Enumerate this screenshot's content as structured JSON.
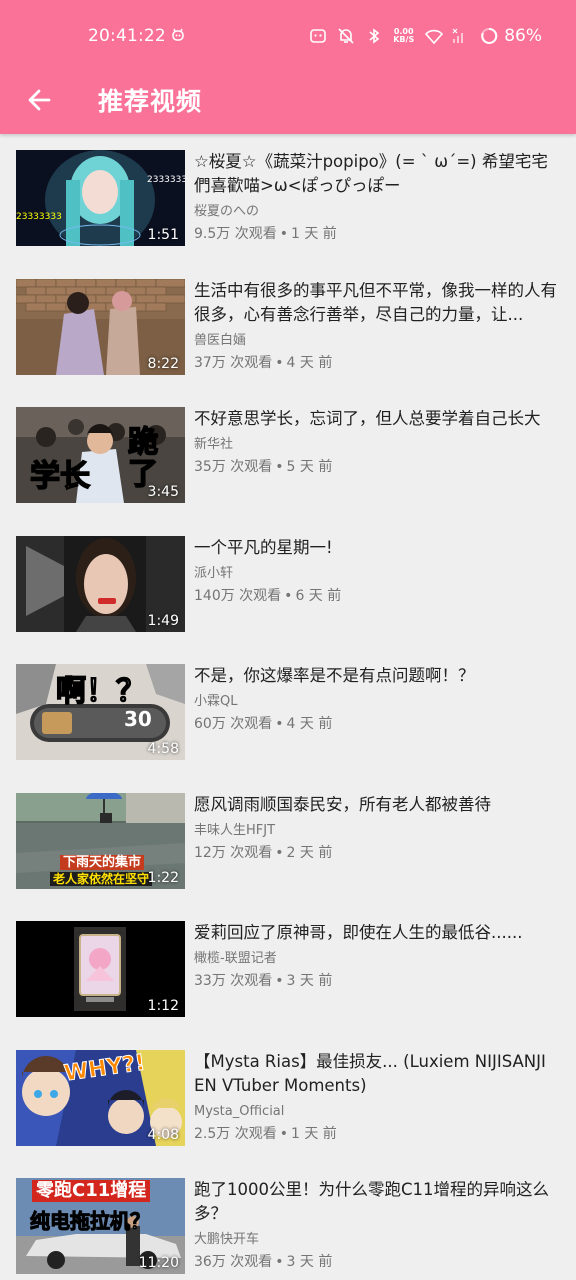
{
  "status_bar": {
    "time": "20:41:22",
    "speed_top": "0.00",
    "speed_unit": "KB/S",
    "battery": "86%"
  },
  "app_bar": {
    "title": "推荐视频"
  },
  "videos": [
    {
      "title": "☆桜夏☆《蔬菜汁popipo》(= ` ω´=) 希望宅宅們喜歡喵>ω<ぽっぴっぽー",
      "channel": "桜夏のへの",
      "views": "9.5万 次观看",
      "age": "1 天 前",
      "duration": "1:51",
      "thumb_overlay": "23333333"
    },
    {
      "title": "生活中有很多的事平凡但不平常，像我一样的人有很多，心有善念行善举，尽自己的力量，让...",
      "channel": "兽医白婳",
      "views": "37万 次观看",
      "age": "4 天 前",
      "duration": "8:22"
    },
    {
      "title": "不好意思学长，忘词了，但人总要学着自己长大",
      "channel": "新华社",
      "views": "35万 次观看",
      "age": "5 天 前",
      "duration": "3:45",
      "thumb_caption_left": "学长",
      "thumb_caption_right": "跪了"
    },
    {
      "title": "一个平凡的星期一!",
      "channel": "派小轩",
      "views": "140万 次观看",
      "age": "6 天 前",
      "duration": "1:49"
    },
    {
      "title": "不是，你这爆率是不是有点问题啊！？",
      "channel": "小霖QL",
      "views": "60万 次观看",
      "age": "4 天 前",
      "duration": "4:58",
      "thumb_caption": "啊！？",
      "thumb_number": "30"
    },
    {
      "title": "愿风调雨顺国泰民安，所有老人都被善待",
      "channel": "丰味人生HFJT",
      "views": "12万 次观看",
      "age": "2 天 前",
      "duration": "1:22",
      "thumb_caption_1": "下雨天的集市",
      "thumb_caption_2": "老人家依然在坚守"
    },
    {
      "title": "爱莉回应了原神哥，即使在人生的最低谷......",
      "channel": "橄榄-联盟记者",
      "views": "33万 次观看",
      "age": "3 天 前",
      "duration": "1:12"
    },
    {
      "title": "【Mysta Rias】最佳损友... (Luxiem NIJISANJI EN VTuber Moments)",
      "channel": "Mysta_Official",
      "views": "2.5万 次观看",
      "age": "1 天 前",
      "duration": "4:08",
      "thumb_caption": "WHY?!"
    },
    {
      "title": "跑了1000公里！为什么零跑C11增程的异响这么多？",
      "channel": "大鹏快开车",
      "views": "36万 次观看",
      "age": "3 天 前",
      "duration": "11:20",
      "thumb_caption_1": "零跑C11增程",
      "thumb_caption_2": "纯电拖拉机？"
    }
  ]
}
